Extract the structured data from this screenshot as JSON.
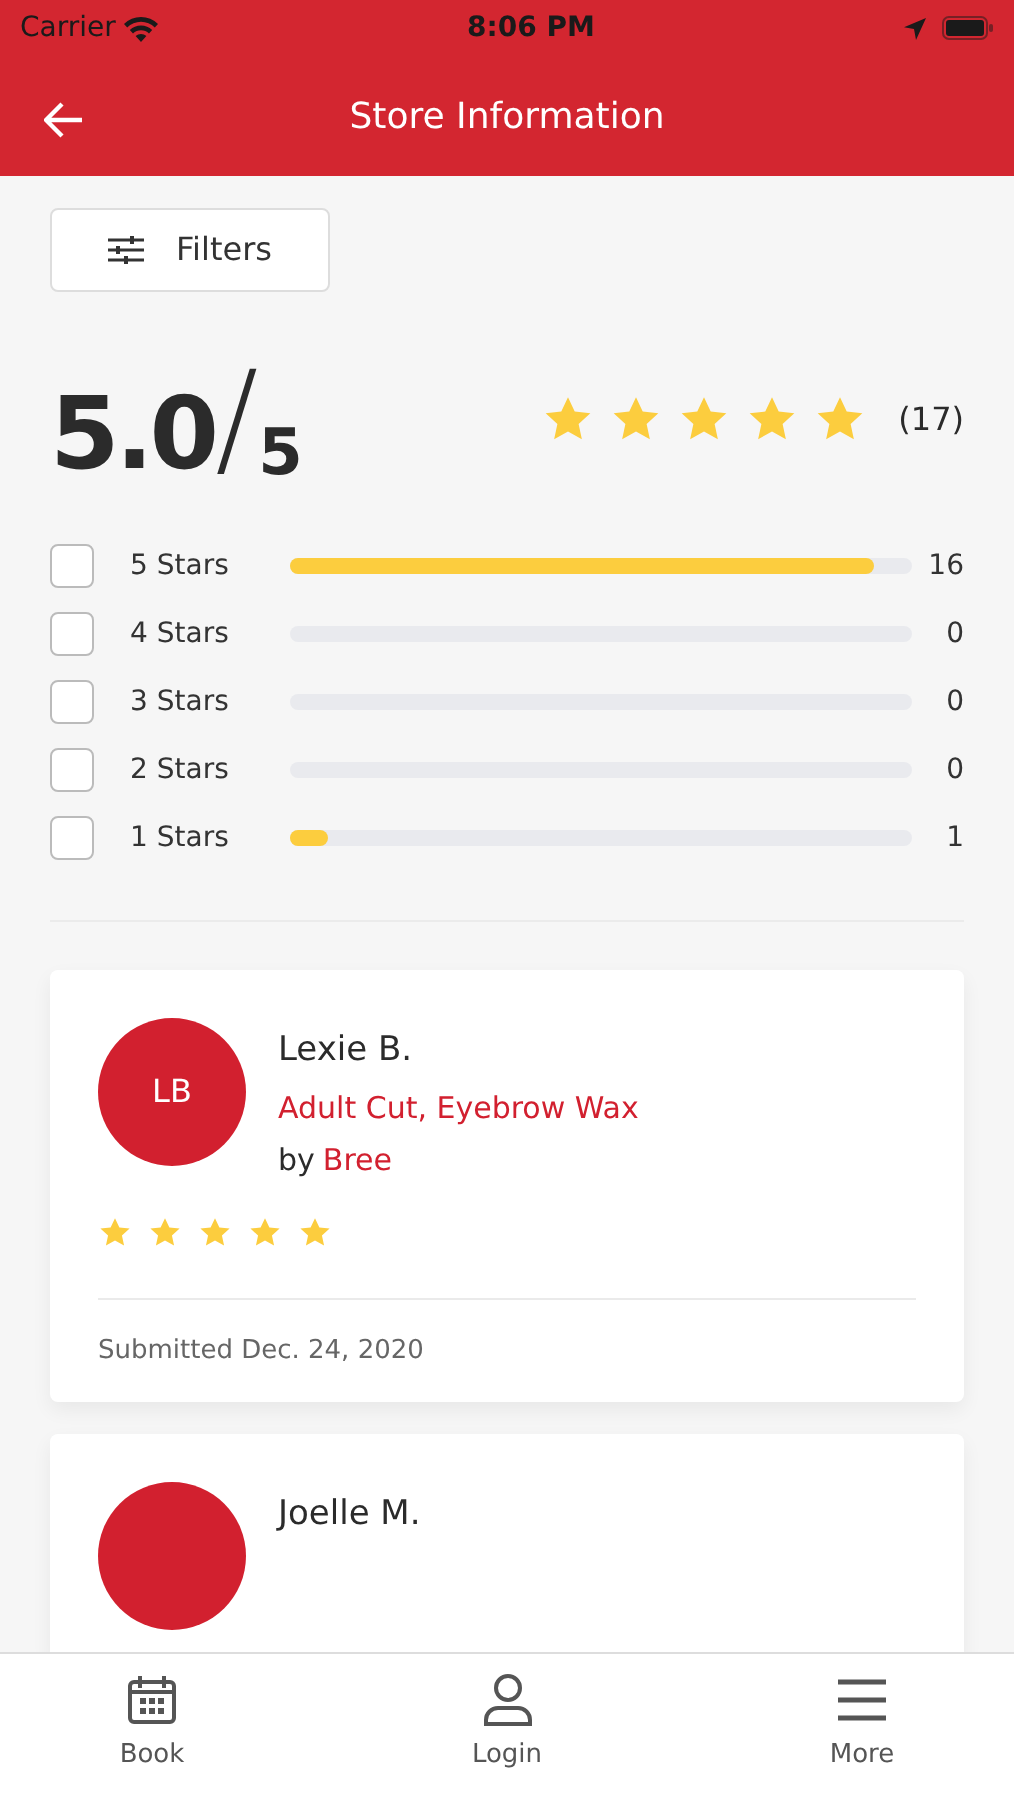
{
  "status_bar": {
    "carrier": "Carrier",
    "time": "8:06 PM"
  },
  "header": {
    "title": "Store Information"
  },
  "filters_button": {
    "label": "Filters"
  },
  "summary": {
    "score": "5.0",
    "separator": "/",
    "out_of": "5",
    "stars": 5,
    "count": "(17)"
  },
  "breakdown": [
    {
      "label": "5 Stars",
      "checked": false,
      "level": 0.94,
      "count": "16"
    },
    {
      "label": "4 Stars",
      "checked": false,
      "level": 0,
      "count": "0"
    },
    {
      "label": "3 Stars",
      "checked": false,
      "level": 0,
      "count": "0"
    },
    {
      "label": "2 Stars",
      "checked": false,
      "level": 0,
      "count": "0"
    },
    {
      "label": "1 Stars",
      "checked": false,
      "level": 0.06,
      "count": "1"
    }
  ],
  "reviews": [
    {
      "initials": "LB",
      "name": "Lexie B.",
      "services": "Adult Cut, Eyebrow Wax",
      "by_prefix": "by",
      "stylist": "Bree",
      "stars": 5,
      "submitted": "Submitted Dec. 24, 2020"
    },
    {
      "name": "Joelle M."
    }
  ],
  "tab_bar": [
    {
      "kind": "calendar",
      "label": "Book"
    },
    {
      "kind": "person",
      "label": "Login"
    },
    {
      "kind": "menu",
      "label": "More"
    }
  ]
}
